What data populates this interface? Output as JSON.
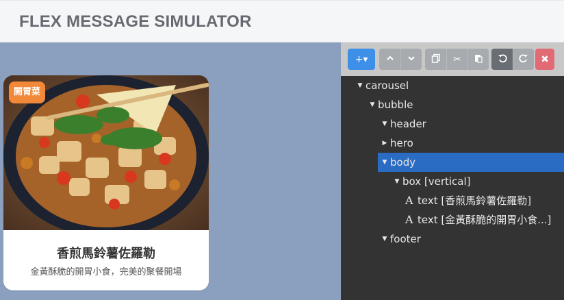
{
  "app": {
    "title": "FLEX MESSAGE SIMULATOR"
  },
  "preview": {
    "background_color": "#8ba0bf",
    "bubble": {
      "hero_image": "stir-fried chicken and vegetables with basil in a dark bowl",
      "badge": "開胃菜",
      "title": "香煎馬鈴薯佐羅勒",
      "subtitle": "金黃酥脆的開胃小食，完美的聚餐開場"
    }
  },
  "toolbar": {
    "add": {
      "icon": "plus-icon",
      "label": "+▾"
    },
    "move_up": {
      "icon": "chevron-up-icon"
    },
    "move_down": {
      "icon": "chevron-down-icon"
    },
    "copy": {
      "icon": "copy-icon"
    },
    "cut": {
      "icon": "scissors-icon"
    },
    "paste": {
      "icon": "paste-icon"
    },
    "undo": {
      "icon": "undo-icon"
    },
    "redo": {
      "icon": "redo-icon"
    },
    "delete": {
      "icon": "close-icon"
    }
  },
  "tree": {
    "nodes": [
      {
        "label": "carousel",
        "expanded": true
      },
      {
        "label": "bubble",
        "expanded": true
      },
      {
        "label": "header",
        "expanded": true
      },
      {
        "label": "hero",
        "expanded": false
      },
      {
        "label": "body",
        "expanded": true,
        "selected": true
      },
      {
        "label": "box [vertical]",
        "expanded": true
      },
      {
        "label": "text [香煎馬鈴薯佐羅勒]",
        "icon": "A"
      },
      {
        "label": "text [金黃酥脆的開胃小食...]",
        "icon": "A"
      },
      {
        "label": "footer",
        "expanded": true
      }
    ]
  },
  "colors": {
    "accent": "#3d8fe8",
    "selected": "#2a6bc4",
    "badge": "#f2893a",
    "danger": "#e26a75",
    "editor_bg": "#333333"
  }
}
